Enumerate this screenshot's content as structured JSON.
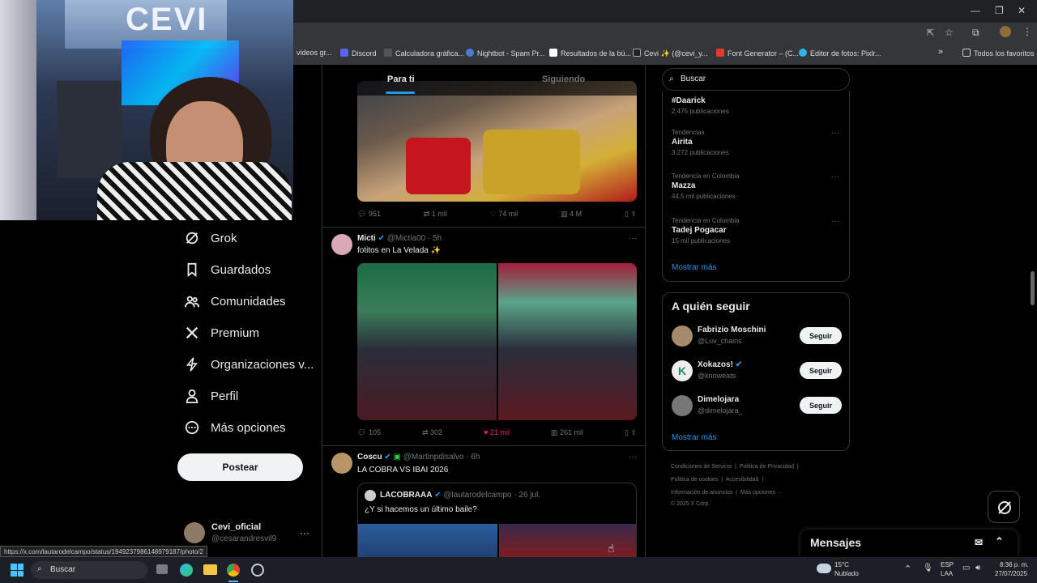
{
  "browser": {
    "bookmarks": [
      "videos gr...",
      "Discord",
      "Calculadora gráfica...",
      "Nightbot - Spam Pr...",
      "Resultados de la bú...",
      "Cevi ✨ (@cevi_y...",
      "Font Generator – (C...",
      "Editor de fotos: Pixlr...",
      "Todos los favoritos"
    ],
    "status_url": "https://x.com/lautarodelcampo/status/1949237986148979187/photo/2"
  },
  "webcam": {
    "sign": "CEVI"
  },
  "nav": {
    "items": [
      {
        "label": "Grok",
        "icon": "grok-icon"
      },
      {
        "label": "Guardados",
        "icon": "bookmark-icon"
      },
      {
        "label": "Comunidades",
        "icon": "communities-icon"
      },
      {
        "label": "Premium",
        "icon": "x-logo-icon"
      },
      {
        "label": "Organizaciones v...",
        "icon": "lightning-icon"
      },
      {
        "label": "Perfil",
        "icon": "person-icon"
      },
      {
        "label": "Más opciones",
        "icon": "more-circle-icon"
      }
    ],
    "post_button": "Postear",
    "account": {
      "name": "Cevi_oficial",
      "handle": "@cesarandresvil9"
    }
  },
  "feed": {
    "tabs": [
      "Para ti",
      "Siguiendo"
    ],
    "tweet0_actions": {
      "replies": "951",
      "retweets": "1 mil",
      "likes": "74 mil",
      "views": "4 M"
    },
    "tweet1": {
      "name": "Micti",
      "handle": "@Mictia00 · 5h",
      "text": "fotitos en La Velada ✨",
      "replies": "105",
      "retweets": "302",
      "likes": "21 mil",
      "views": "261 mil"
    },
    "tweet2": {
      "name": "Coscu",
      "handle": "@Martinpdisalvo · 6h",
      "text": "LA COBRA VS IBAI 2026",
      "quote": {
        "name": "LACOBRAAA",
        "handle": "@lautarodelcampo · 26 jul.",
        "text": "¿Y si hacemos un último baile?"
      }
    }
  },
  "sidebar": {
    "search_placeholder": "Buscar",
    "trends": [
      {
        "context": "",
        "name": "#Daarick",
        "count": "2.475 publicaciones"
      },
      {
        "context": "Tendencias",
        "name": "Airita",
        "count": "3.272 publicaciones"
      },
      {
        "context": "Tendencia en Colombia",
        "name": "Mazza",
        "count": "44,5 mil publicaciones"
      },
      {
        "context": "Tendencia en Colombia",
        "name": "Tadej Pogacar",
        "count": "15 mil publicaciones"
      }
    ],
    "show_more": "Mostrar más",
    "who_title": "A quién seguir",
    "who": [
      {
        "name": "Fabrizio Moschini",
        "handle": "@Luv_chains"
      },
      {
        "name": "Xokazos!",
        "handle": "@knoweats"
      },
      {
        "name": "Dimelojara",
        "handle": "@dimelojara_"
      }
    ],
    "follow_label": "Seguir",
    "show_more2": "Mostrar más",
    "footer": [
      "Condiciones de Servicio",
      "Política de Privacidad",
      "Política de cookies",
      "Accesibilidad",
      "Información de anuncios",
      "Más opciones ···",
      "© 2025 X Corp."
    ]
  },
  "messages": {
    "title": "Mensajes"
  },
  "taskbar": {
    "search": "Buscar",
    "weather_temp": "15°C",
    "weather_desc": "Nublado",
    "lang1": "ESP",
    "lang2": "LAA",
    "time": "8:36 p. m.",
    "date": "27/07/2025"
  }
}
